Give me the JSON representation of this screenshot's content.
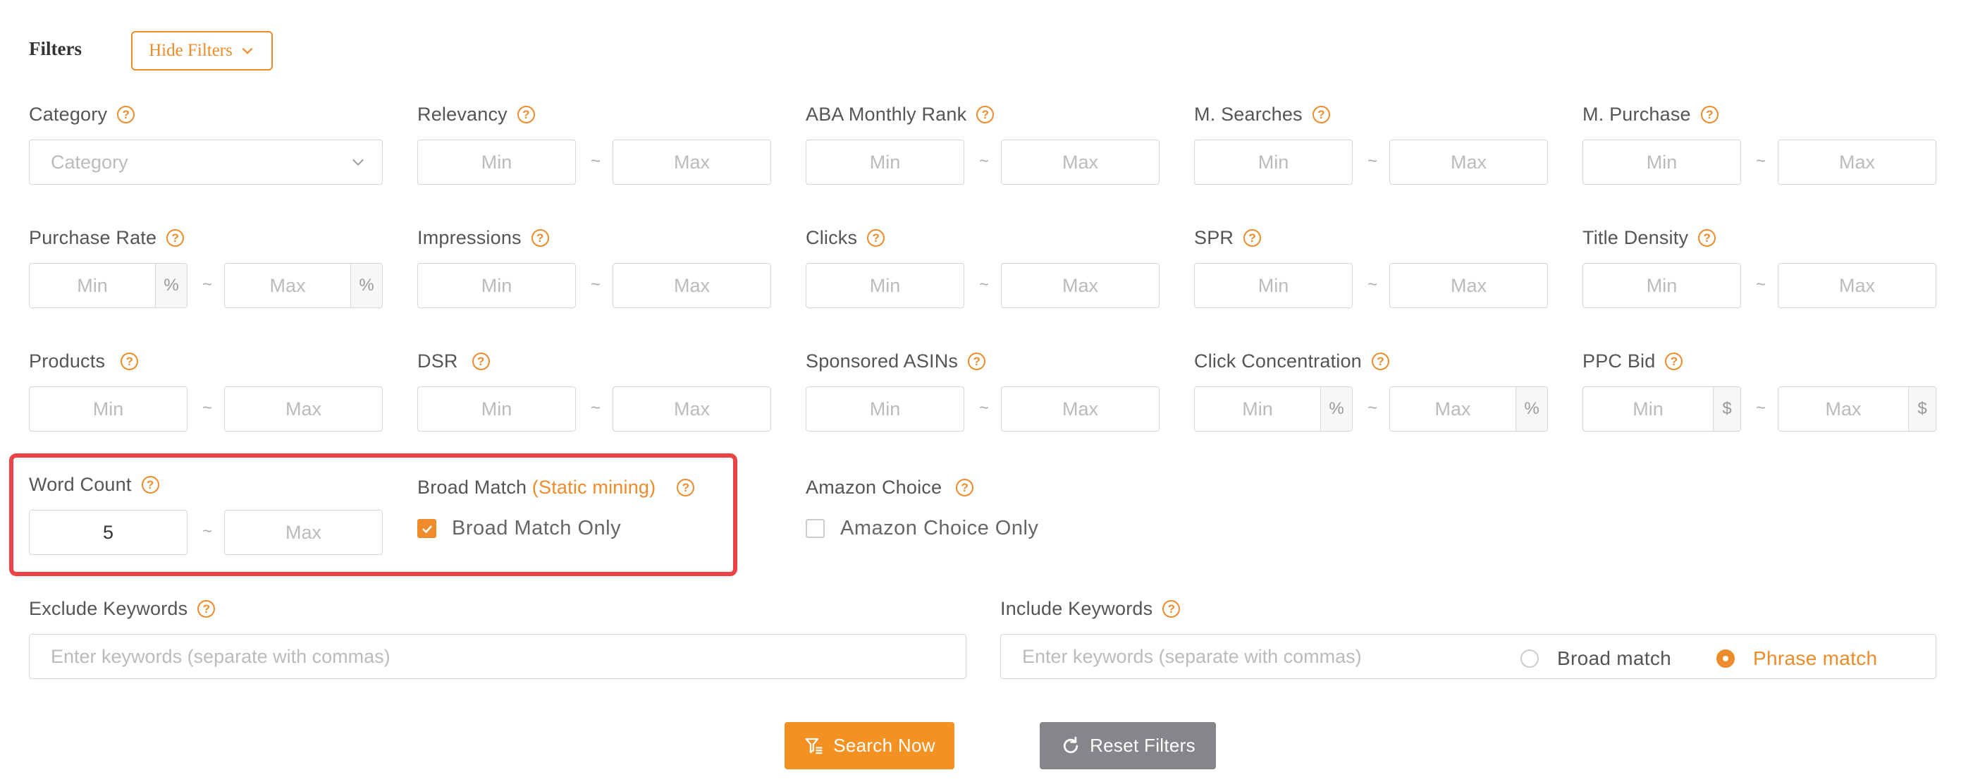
{
  "header": {
    "title": "Filters",
    "hide_filters_label": "Hide Filters"
  },
  "placeholders": {
    "min": "Min",
    "max": "Max",
    "tilde": "~",
    "help": "?"
  },
  "fields": {
    "category": {
      "label": "Category",
      "placeholder": "Category"
    },
    "relevancy": {
      "label": "Relevancy"
    },
    "aba_rank": {
      "label": "ABA Monthly Rank"
    },
    "m_searches": {
      "label": "M. Searches"
    },
    "m_purchase": {
      "label": "M. Purchase"
    },
    "purchase_rate": {
      "label": "Purchase Rate",
      "unit": "%"
    },
    "impressions": {
      "label": "Impressions"
    },
    "clicks": {
      "label": "Clicks"
    },
    "spr": {
      "label": "SPR"
    },
    "title_density": {
      "label": "Title Density"
    },
    "products": {
      "label": "Products"
    },
    "dsr": {
      "label": "DSR"
    },
    "sponsored_asins": {
      "label": "Sponsored ASINs"
    },
    "click_concentration": {
      "label": "Click Concentration",
      "unit": "%"
    },
    "ppc_bid": {
      "label": "PPC Bid",
      "unit": "$"
    },
    "word_count": {
      "label": "Word Count",
      "min_value": "5"
    },
    "broad_match": {
      "label": "Broad Match",
      "label_highlight": "(Static mining)",
      "checkbox_label": "Broad Match Only",
      "checked": true
    },
    "amazon_choice": {
      "label": "Amazon Choice",
      "checkbox_label": "Amazon Choice Only",
      "checked": false
    },
    "exclude_keywords": {
      "label": "Exclude Keywords",
      "placeholder": "Enter keywords (separate with commas)"
    },
    "include_keywords": {
      "label": "Include Keywords",
      "placeholder": "Enter keywords (separate with commas)",
      "options": [
        "Broad match",
        "Phrase match"
      ],
      "selected": "Phrase match"
    }
  },
  "actions": {
    "search_label": "Search Now",
    "reset_label": "Reset Filters"
  },
  "colors": {
    "accent": "#ee8b2a",
    "highlight": "#ec4446",
    "reset": "#85868a"
  }
}
